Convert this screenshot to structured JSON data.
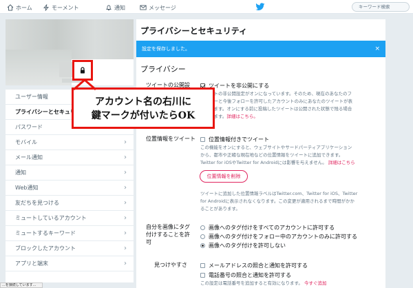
{
  "nav": {
    "home": "ホーム",
    "moments": "モーメント",
    "notifications": "通知",
    "messages": "メッセージ",
    "search_placeholder": "キーワード検索"
  },
  "menu": {
    "items": [
      {
        "label": "ユーザー情報"
      },
      {
        "label": "プライバシーとセキュリティ"
      },
      {
        "label": "パスワード"
      },
      {
        "label": "モバイル"
      },
      {
        "label": "メール通知"
      },
      {
        "label": "通知"
      },
      {
        "label": "Web通知"
      },
      {
        "label": "友だちを見つける"
      },
      {
        "label": "ミュートしているアカウント"
      },
      {
        "label": "ミュートするキーワード"
      },
      {
        "label": "ブロックしたアカウント"
      },
      {
        "label": "アプリと端末"
      }
    ]
  },
  "callout": {
    "line1": "アカウント名の右川に",
    "line2": "鍵マークが付いたらOK"
  },
  "main": {
    "title": "プライバシーとセキュリティ",
    "banner": "設定を保存しました。",
    "banner_close": "×",
    "section": "プライバシー",
    "tweet_privacy": {
      "label": "ツイートの公開設定",
      "option": "ツイートを非公開にする",
      "desc_1": "ツイートの非公開設定がオンになっています。そのため、現在のあなたのフ",
      "desc_2": "ォロワーと今後フォローを許可したアカウントのみにあなたのツイートが表",
      "desc_3": "示されます。オンにする前に投稿したツイートは公開された状態で残る場合",
      "desc_4": "があります。",
      "link": "詳細はこちら。"
    },
    "location": {
      "label": "位置情報をツイート",
      "option": "位置情報付きでツイート",
      "desc_1": "この機能をオンにすると、ウェブサイトやサードパーティアプリケーション",
      "desc_2": "から、都市や正確な現在地などの位置情報をツイートに追加できます。",
      "desc_3": "Twitter for iOSやTwitter for Androidには影響を与えません。",
      "link": "詳細はこちら",
      "delete_button": "位置情報を削除",
      "desc2_1": "ツイートに追加した位置情報ラベルはTwitter.com、Twitter for iOS、Twitter",
      "desc2_2": "for Androidに表示されなくなります。この変更が適用されるまで時間がかか",
      "desc2_3": "ることがあります。"
    },
    "photo_tag": {
      "label_1": "自分を画像にタグ",
      "label_2": "付けすることを許",
      "label_3": "可",
      "options": [
        {
          "label": "画像へのタグ付けをすべてのアカウントに許可する",
          "selected": false
        },
        {
          "label": "画像へのタグ付けをフォロー中のアカウントのみに許可する",
          "selected": false
        },
        {
          "label": "画像へのタグ付けを許可しない",
          "selected": true
        }
      ]
    },
    "discoverability": {
      "label": "見つけやすさ",
      "option_email": "メールアドレスの照合と通知を許可する",
      "option_phone": "電話番号の照合と通知を許可する",
      "desc": "この設定は電話番号を追加すると有効になります。",
      "link": "今すぐ追加"
    }
  },
  "statusbar": {
    "text": "...を接続しています..."
  },
  "colors": {
    "accent": "#1da1f2",
    "highlight": "#e8150f",
    "danger": "#e0245e"
  }
}
